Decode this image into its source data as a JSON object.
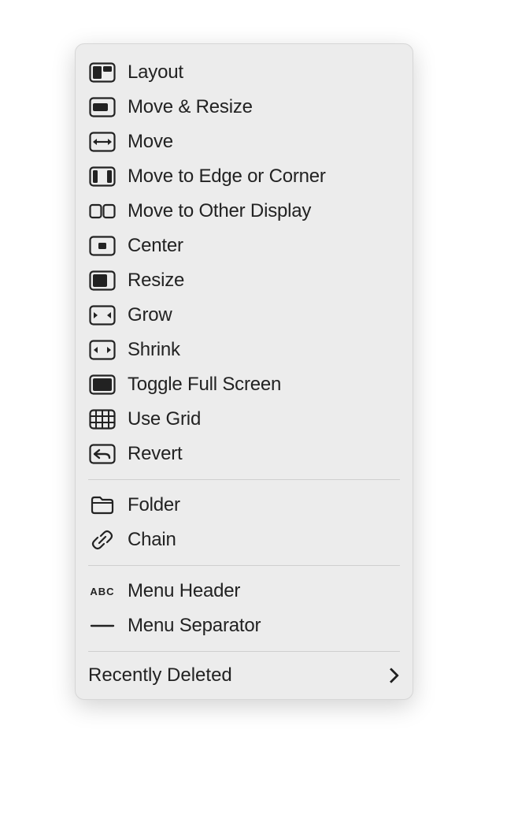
{
  "menu": {
    "groups": [
      {
        "items": [
          {
            "icon": "layout-icon",
            "label": "Layout"
          },
          {
            "icon": "move-resize-icon",
            "label": "Move & Resize"
          },
          {
            "icon": "move-icon",
            "label": "Move"
          },
          {
            "icon": "move-edge-corner-icon",
            "label": "Move to Edge or Corner"
          },
          {
            "icon": "move-display-icon",
            "label": "Move to Other Display"
          },
          {
            "icon": "center-icon",
            "label": "Center"
          },
          {
            "icon": "resize-icon",
            "label": "Resize"
          },
          {
            "icon": "grow-icon",
            "label": "Grow"
          },
          {
            "icon": "shrink-icon",
            "label": "Shrink"
          },
          {
            "icon": "fullscreen-icon",
            "label": "Toggle Full Screen"
          },
          {
            "icon": "grid-icon",
            "label": "Use Grid"
          },
          {
            "icon": "revert-icon",
            "label": "Revert"
          }
        ]
      },
      {
        "items": [
          {
            "icon": "folder-icon",
            "label": "Folder"
          },
          {
            "icon": "chain-icon",
            "label": "Chain"
          }
        ]
      },
      {
        "items": [
          {
            "icon": "abc-icon",
            "label": "Menu Header"
          },
          {
            "icon": "separator-icon",
            "label": "Menu Separator"
          }
        ]
      }
    ],
    "footer": {
      "label": "Recently Deleted"
    }
  }
}
